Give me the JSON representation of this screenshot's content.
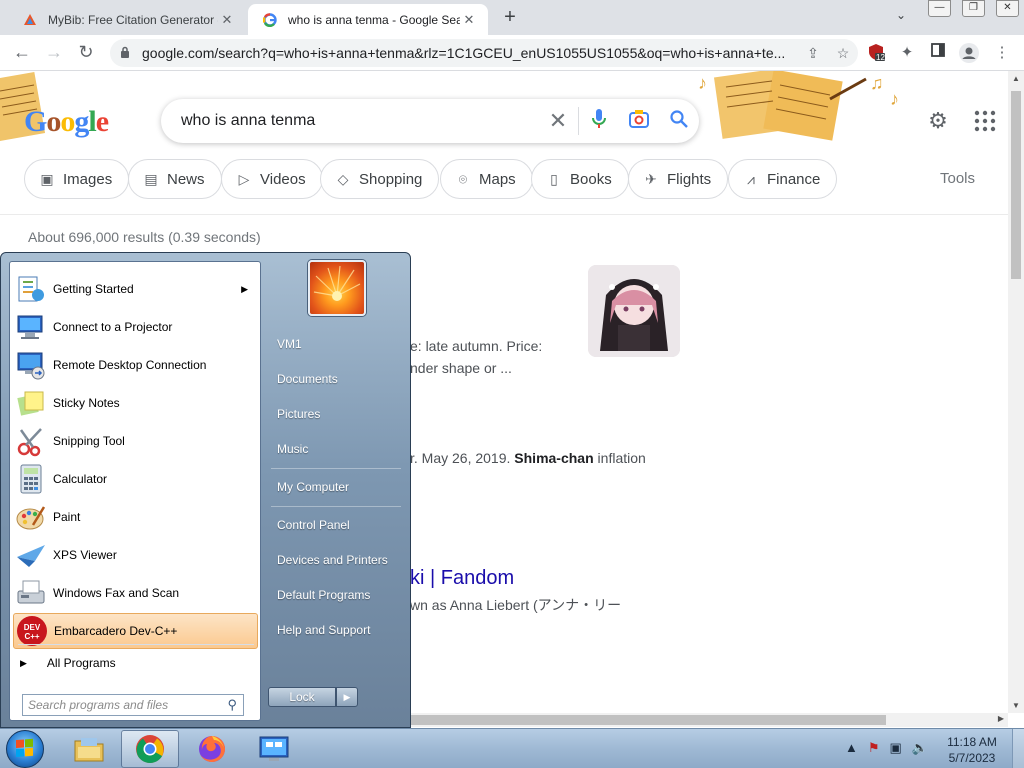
{
  "browser": {
    "tabs": [
      {
        "title": "MyBib: Free Citation Generator -",
        "active": false
      },
      {
        "title": "who is anna tenma - Google Sea",
        "active": true
      }
    ],
    "url": "google.com/search?q=who+is+anna+tenma&rlz=1C1GCEU_enUS1055US1055&oq=who+is+anna+te...",
    "extension_badge": "12"
  },
  "google": {
    "logo_text": "Google",
    "query": "who is anna tenma",
    "chips": [
      "Images",
      "News",
      "Videos",
      "Shopping",
      "Maps",
      "Books",
      "Flights",
      "Finance"
    ],
    "tools_label": "Tools",
    "result_stats": "About 696,000 results (0.39 seconds)",
    "snippets": {
      "line1": "e: late autumn. Price:",
      "line2": "nder shape or ...",
      "line3_pre": "r. May 26, 2019. ",
      "line3_bold": "Shima-chan",
      "line3_post": " inflation",
      "result_title": "ki | Fandom",
      "line4": "wn as Anna Liebert (アンナ・リー"
    }
  },
  "start_menu": {
    "programs": [
      {
        "label": "Getting Started",
        "icon": "getting-started-icon",
        "submenu": true
      },
      {
        "label": "Connect to a Projector",
        "icon": "projector-icon"
      },
      {
        "label": "Remote Desktop Connection",
        "icon": "remote-desktop-icon"
      },
      {
        "label": "Sticky Notes",
        "icon": "sticky-notes-icon"
      },
      {
        "label": "Snipping Tool",
        "icon": "snipping-tool-icon"
      },
      {
        "label": "Calculator",
        "icon": "calculator-icon"
      },
      {
        "label": "Paint",
        "icon": "paint-icon"
      },
      {
        "label": "XPS Viewer",
        "icon": "xps-viewer-icon"
      },
      {
        "label": "Windows Fax and Scan",
        "icon": "fax-scan-icon"
      },
      {
        "label": "Embarcadero Dev-C++",
        "icon": "devcpp-icon",
        "highlighted": true
      }
    ],
    "all_programs": "All Programs",
    "search_placeholder": "Search programs and files",
    "right_items": [
      "VM1",
      "Documents",
      "Pictures",
      "Music",
      "My Computer",
      "Control Panel",
      "Devices and Printers",
      "Default Programs",
      "Help and Support"
    ],
    "lock_label": "Lock"
  },
  "taskbar": {
    "apps": [
      "file-explorer-icon",
      "chrome-icon",
      "firefox-icon",
      "remote-desktop-icon"
    ],
    "clock_time": "11:18 AM",
    "clock_date": "5/7/2023"
  }
}
